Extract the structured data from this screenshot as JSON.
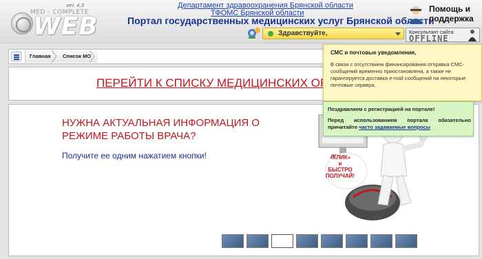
{
  "logo": {
    "version": "ver. 4.3",
    "brand": "MED - COMPLETE",
    "wordmark": "WEB"
  },
  "header": {
    "link_department": "Департамент здравоохранения Брянской области",
    "link_fund": "ТФОМС Брянской области",
    "portal_title": "Портал государственных медицинских услуг Брянской области",
    "greeting": "Здравствуйте,",
    "help_line1": "Помощь и",
    "help_line2": "поддержка",
    "consultant_label": "Консультант сайта",
    "consultant_status": "OFFLINE"
  },
  "breadcrumb": {
    "items": [
      "Главная",
      "Список МО"
    ]
  },
  "banner": {
    "link_text": "ПЕРЕЙТИ К СПИСКУ МЕДИЦИНСКИХ ОРГАН"
  },
  "promo": {
    "heading": "НУЖНА АКТУАЛЬНАЯ ИНФОРМАЦИЯ О РЕЖИМЕ РАБОТЫ ВРАЧА?",
    "subtext": "Получите ее одним нажатием кнопки!",
    "bubble_line1": "«КЛИК»",
    "bubble_line2": "и",
    "bubble_line3": "БЫСТРО",
    "bubble_line4": "ПОЛУЧАЙ!",
    "active_thumb": 3,
    "thumb_count": 8
  },
  "notifications": {
    "sms_title": "СМС и почтовые уведомления,",
    "sms_body": "В связи с отсутствием финансирования отправка СМС-сообщений временно приостановлена, а также не гарантируется доставка e-mail сообщений на некоторые почтовые сервера.",
    "reg_title": "Поздравляем с регистрацией на портале!",
    "reg_body": "Перед использованием портала обязательно причитайте",
    "reg_link": "часто задаваемые вопросы"
  },
  "colors": {
    "accent_red": "#c0161d",
    "link_blue": "#1a3fa8",
    "note_yellow": "#fff8c4",
    "note_green": "#d9f5c4"
  }
}
